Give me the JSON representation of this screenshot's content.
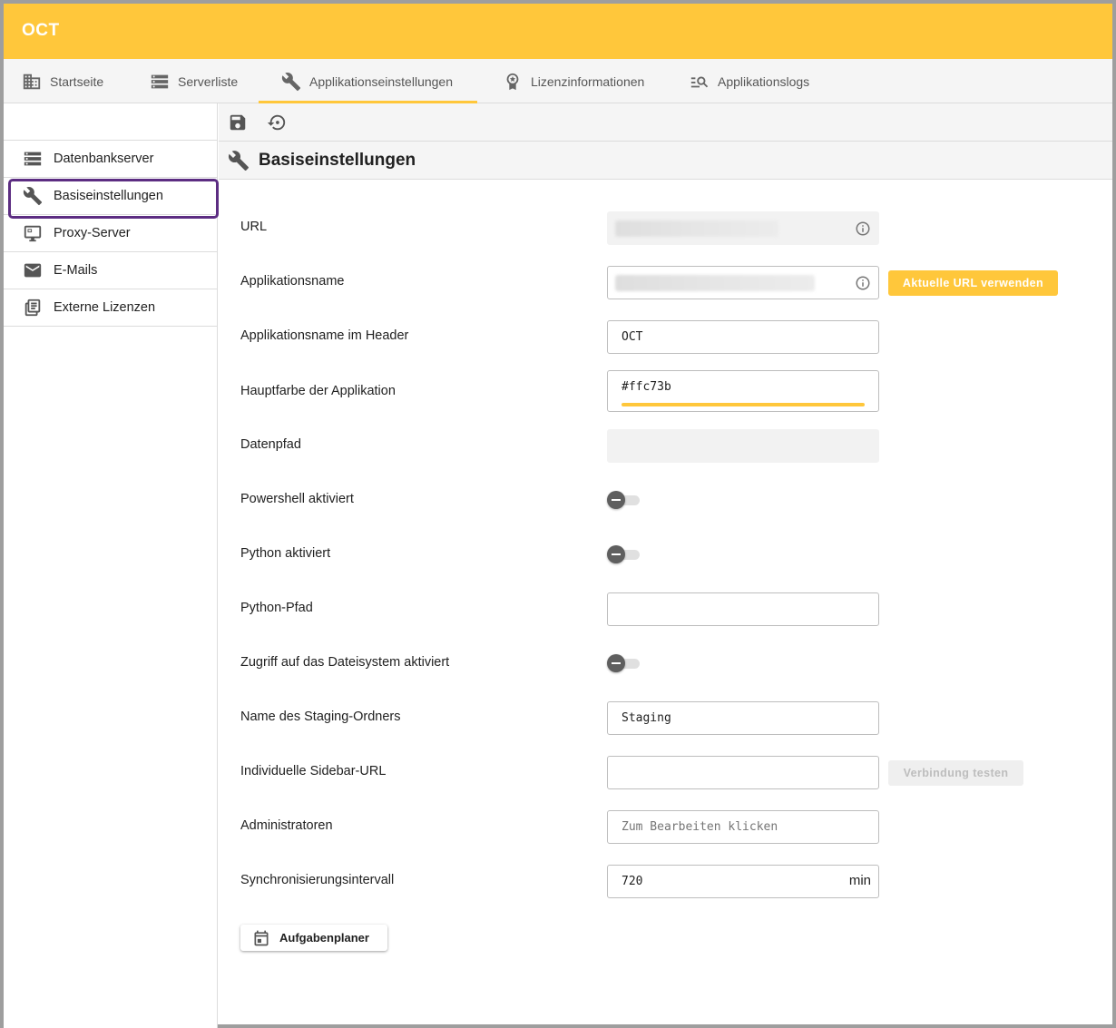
{
  "app": {
    "title": "OCT",
    "accent_color": "#ffc73b"
  },
  "tabs": [
    {
      "label": "Startseite",
      "icon": "building-icon"
    },
    {
      "label": "Serverliste",
      "icon": "server-list-icon"
    },
    {
      "label": "Applikationseinstellungen",
      "icon": "wrench-icon",
      "active": true
    },
    {
      "label": "Lizenzinformationen",
      "icon": "license-badge-icon"
    },
    {
      "label": "Applikationslogs",
      "icon": "log-search-icon"
    }
  ],
  "sidebar": {
    "items": [
      {
        "label": "Datenbankserver",
        "icon": "database-server-icon"
      },
      {
        "label": "Basiseinstellungen",
        "icon": "wrench-icon",
        "selected": true
      },
      {
        "label": "Proxy-Server",
        "icon": "proxy-monitor-icon"
      },
      {
        "label": "E-Mails",
        "icon": "mail-icon"
      },
      {
        "label": "Externe Lizenzen",
        "icon": "document-icon"
      }
    ]
  },
  "toolbar": {
    "save_icon": "save-icon",
    "reset_icon": "restore-icon"
  },
  "section": {
    "title": "Basiseinstellungen",
    "icon": "wrench-icon"
  },
  "form": {
    "url": {
      "label": "URL",
      "value": ""
    },
    "app_name": {
      "label": "Applikationsname",
      "value": "",
      "button": "Aktuelle URL verwenden"
    },
    "header_name": {
      "label": "Applikationsname im Header",
      "value": "OCT"
    },
    "main_color": {
      "label": "Hauptfarbe der Applikation",
      "value": "#ffc73b",
      "color": "#ffc73b"
    },
    "data_path": {
      "label": "Datenpfad",
      "value": ""
    },
    "powershell": {
      "label": "Powershell aktiviert",
      "enabled": false
    },
    "python": {
      "label": "Python aktiviert",
      "enabled": false
    },
    "python_path": {
      "label": "Python-Pfad",
      "value": ""
    },
    "fs_access": {
      "label": "Zugriff auf das Dateisystem aktiviert",
      "enabled": false
    },
    "staging": {
      "label": "Name des Staging-Ordners",
      "value": "Staging"
    },
    "sidebar_url": {
      "label": "Individuelle Sidebar-URL",
      "value": "",
      "button": "Verbindung testen"
    },
    "admins": {
      "label": "Administratoren",
      "placeholder": "Zum Bearbeiten klicken"
    },
    "sync": {
      "label": "Synchronisierungsintervall",
      "value": "720",
      "unit": "min"
    },
    "scheduler_button": "Aufgabenplaner"
  }
}
